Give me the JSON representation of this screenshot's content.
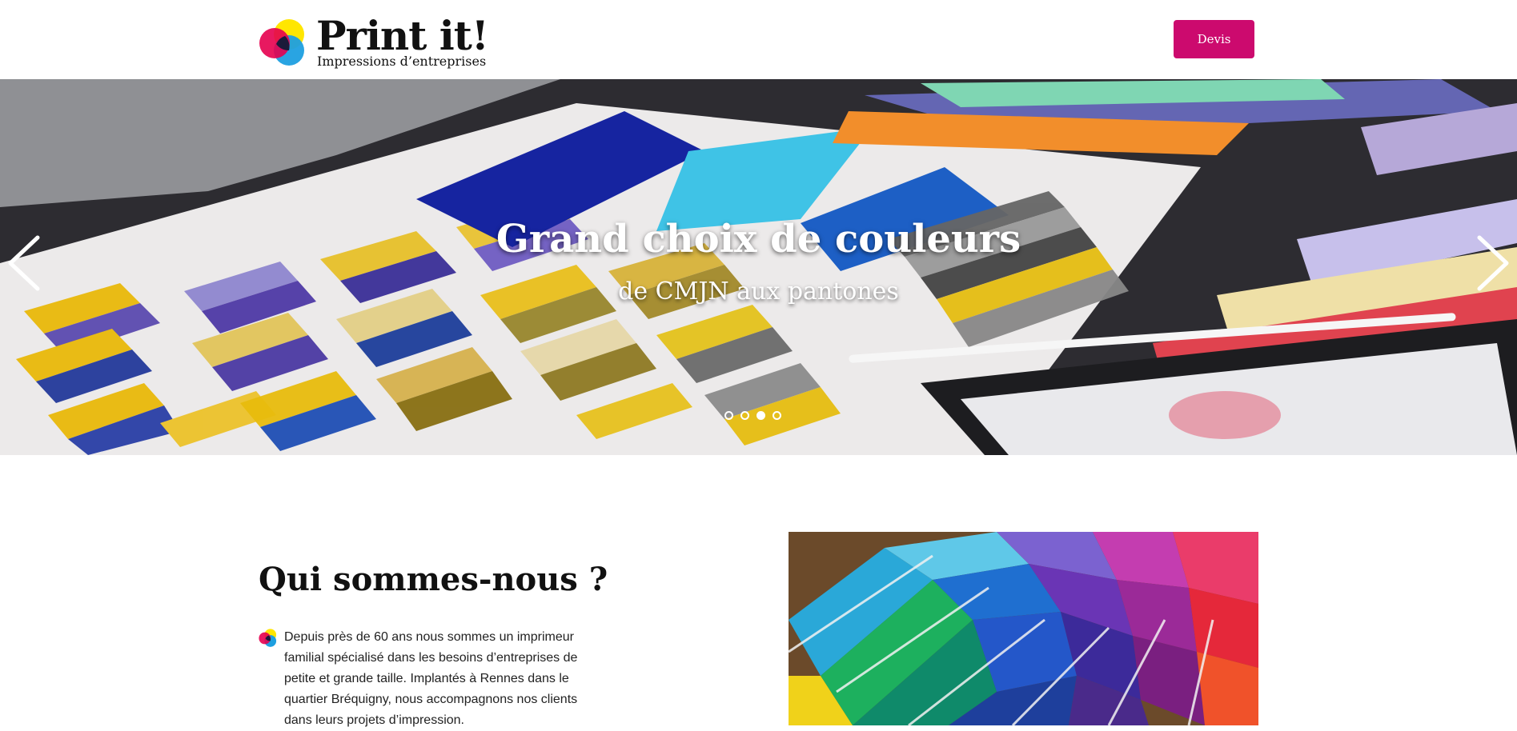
{
  "header": {
    "logo_title": "Print it!",
    "logo_tagline": "Impressions d’entreprises",
    "cta_label": "Devis"
  },
  "hero": {
    "title": "Grand choix de couleurs",
    "subtitle": "de CMJN aux pantones",
    "slides_count": 4,
    "active_slide": 3,
    "prev_icon": "chevron-left-icon",
    "next_icon": "chevron-right-icon"
  },
  "about": {
    "title": "Qui sommes-nous ?",
    "text": "Depuis près de 60 ans nous sommes un imprimeur familial spécialisé dans les besoins d’entreprises de petite et grande taille. Implantés à Rennes dans le quartier Bréquigny, nous accompagnons nos clients dans leurs projets d’impression."
  },
  "colors": {
    "brand_magenta": "#cc0a6e",
    "logo_cyan": "#1d9fe0",
    "logo_yellow": "#ffe600",
    "logo_red": "#e5004f"
  }
}
